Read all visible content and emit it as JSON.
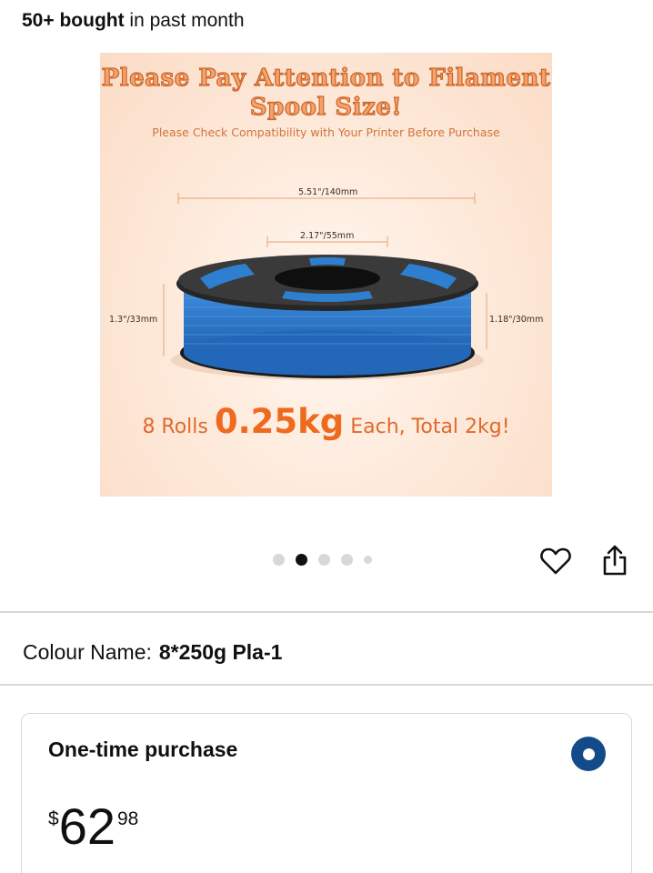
{
  "header": {
    "bought_count": "50+ bought",
    "bought_suffix": " in past month"
  },
  "image": {
    "title_line1": "Please Pay Attention to Filament",
    "title_line2": "Spool Size!",
    "subtitle": "Please Check Compatibility with Your Printer Before Purchase",
    "dim_outer": "5.51\"/140mm",
    "dim_inner": "2.17\"/55mm",
    "dim_left_height": "1.3\"/33mm",
    "dim_right_height": "1.18\"/30mm",
    "rolls_prefix": "8 Rolls ",
    "rolls_weight": "0.25kg",
    "rolls_suffix": " Each, Total 2kg!",
    "filament_color": "#2f7fd0"
  },
  "carousel": {
    "total_dots": 5,
    "active_index": 1
  },
  "actions": {
    "wishlist_icon": "heart-icon",
    "share_icon": "share-icon"
  },
  "colour": {
    "label": "Colour Name:",
    "value": "8*250g Pla-1"
  },
  "purchase": {
    "title": "One-time purchase",
    "selected": true,
    "price_symbol": "$",
    "price_whole": "62",
    "price_fraction": "98",
    "accent_color": "#134a8a"
  }
}
